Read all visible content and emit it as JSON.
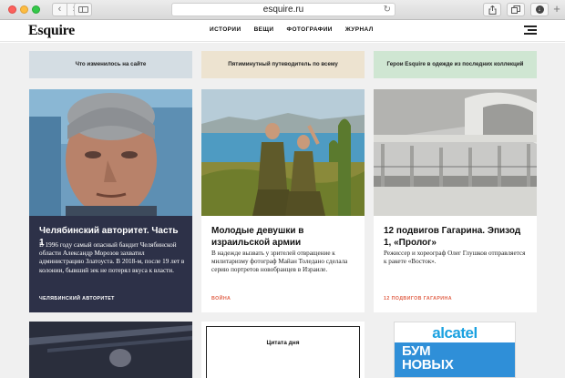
{
  "browser": {
    "url": "esquire.ru",
    "back_icon": "‹",
    "forward_icon": "›",
    "reload_icon": "↻",
    "new_tab_icon": "+"
  },
  "site": {
    "logo": "Esquire",
    "nav": [
      "ИСТОРИИ",
      "ВЕЩИ",
      "ФОТОГРАФИИ",
      "ЖУРНАЛ"
    ]
  },
  "banners": [
    {
      "label": "Что изменилось на сайте",
      "color": "#d4dde3"
    },
    {
      "label": "Пятиминутный путеводитель по всему",
      "color": "#ede3d0"
    },
    {
      "label": "Герои Esquire в одежде из последних коллекций",
      "color": "#cfe6d2"
    }
  ],
  "cards": [
    {
      "title": "Челябинский авторитет. Часть 1",
      "text": "В 1996 году самый опасный бандит Челябинской области Александр Морозов захватил администрацию Златоуста. В 2018-м, после 19 лет в колонии, бывший зек не потерял вкуса к власти.",
      "tag": "ЧЕЛЯБИНСКИЙ АВТОРИТЕТ"
    },
    {
      "title": "Молодые девушки в израильской армии",
      "text": "В надежде вызвать у зрителей отвращение к милитаризму фотограф Майан Толедано сделала серию портретов новобранцев в Израиле.",
      "tag": "ВОЙНА"
    },
    {
      "title": "12 подвигов Гагарина. Эпизод 1, «Пролог»",
      "text": "Режиссер и хореограф Олег Глушков отправляется к ракете «Восток».",
      "tag": "12 ПОДВИГОВ ГАГАРИНА"
    }
  ],
  "quote_label": "Цитата дня",
  "ad": {
    "brand": "alcatel",
    "line1": "БУМ",
    "line2": "НОВЫХ"
  }
}
